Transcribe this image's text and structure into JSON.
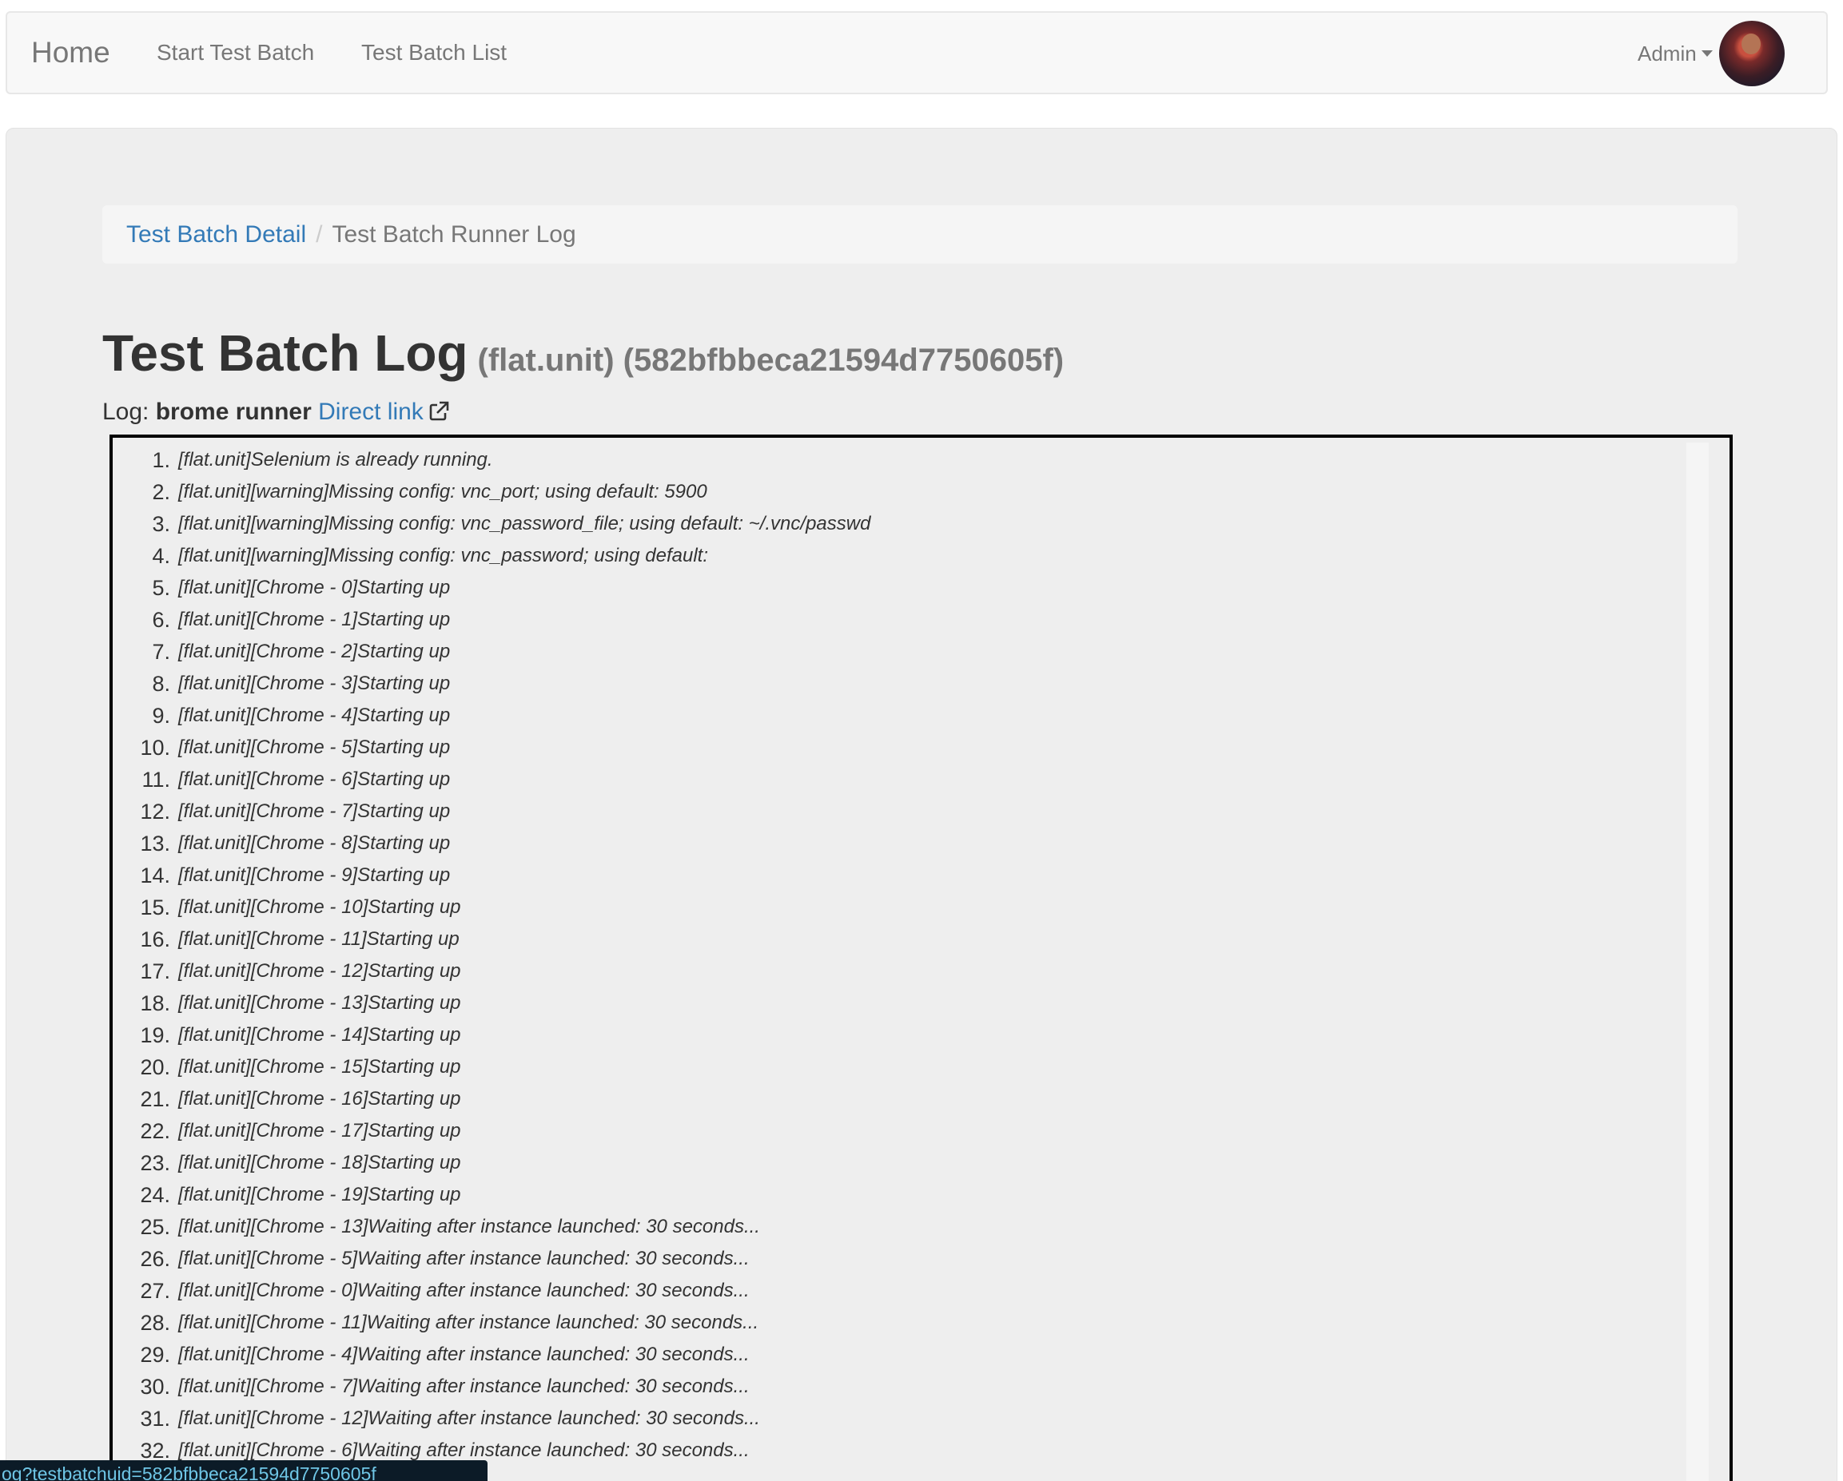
{
  "navbar": {
    "brand": "Home",
    "links": [
      "Start Test Batch",
      "Test Batch List"
    ],
    "user_label": "Admin"
  },
  "breadcrumb": {
    "link": "Test Batch Detail",
    "separator": "/",
    "active": "Test Batch Runner Log"
  },
  "header": {
    "title": "Test Batch Log",
    "subtitle": "(flat.unit) (582bfbbeca21594d7750605f)"
  },
  "log_info": {
    "prefix": "Log:",
    "name": "brome runner",
    "direct_link": "Direct link"
  },
  "log_lines": [
    {
      "num": "1.",
      "text": "[flat.unit]Selenium is already running."
    },
    {
      "num": "2.",
      "text": "[flat.unit][warning]Missing config: vnc_port; using default: 5900"
    },
    {
      "num": "3.",
      "text": "[flat.unit][warning]Missing config: vnc_password_file; using default: ~/.vnc/passwd"
    },
    {
      "num": "4.",
      "text": "[flat.unit][warning]Missing config: vnc_password; using default:"
    },
    {
      "num": "5.",
      "text": "[flat.unit][Chrome - 0]Starting up"
    },
    {
      "num": "6.",
      "text": "[flat.unit][Chrome - 1]Starting up"
    },
    {
      "num": "7.",
      "text": "[flat.unit][Chrome - 2]Starting up"
    },
    {
      "num": "8.",
      "text": "[flat.unit][Chrome - 3]Starting up"
    },
    {
      "num": "9.",
      "text": "[flat.unit][Chrome - 4]Starting up"
    },
    {
      "num": "10.",
      "text": "[flat.unit][Chrome - 5]Starting up"
    },
    {
      "num": "11.",
      "text": "[flat.unit][Chrome - 6]Starting up"
    },
    {
      "num": "12.",
      "text": "[flat.unit][Chrome - 7]Starting up"
    },
    {
      "num": "13.",
      "text": "[flat.unit][Chrome - 8]Starting up"
    },
    {
      "num": "14.",
      "text": "[flat.unit][Chrome - 9]Starting up"
    },
    {
      "num": "15.",
      "text": "[flat.unit][Chrome - 10]Starting up"
    },
    {
      "num": "16.",
      "text": "[flat.unit][Chrome - 11]Starting up"
    },
    {
      "num": "17.",
      "text": "[flat.unit][Chrome - 12]Starting up"
    },
    {
      "num": "18.",
      "text": "[flat.unit][Chrome - 13]Starting up"
    },
    {
      "num": "19.",
      "text": "[flat.unit][Chrome - 14]Starting up"
    },
    {
      "num": "20.",
      "text": "[flat.unit][Chrome - 15]Starting up"
    },
    {
      "num": "21.",
      "text": "[flat.unit][Chrome - 16]Starting up"
    },
    {
      "num": "22.",
      "text": "[flat.unit][Chrome - 17]Starting up"
    },
    {
      "num": "23.",
      "text": "[flat.unit][Chrome - 18]Starting up"
    },
    {
      "num": "24.",
      "text": "[flat.unit][Chrome - 19]Starting up"
    },
    {
      "num": "25.",
      "text": "[flat.unit][Chrome - 13]Waiting after instance launched: 30 seconds..."
    },
    {
      "num": "26.",
      "text": "[flat.unit][Chrome - 5]Waiting after instance launched: 30 seconds..."
    },
    {
      "num": "27.",
      "text": "[flat.unit][Chrome - 0]Waiting after instance launched: 30 seconds..."
    },
    {
      "num": "28.",
      "text": "[flat.unit][Chrome - 11]Waiting after instance launched: 30 seconds..."
    },
    {
      "num": "29.",
      "text": "[flat.unit][Chrome - 4]Waiting after instance launched: 30 seconds..."
    },
    {
      "num": "30.",
      "text": "[flat.unit][Chrome - 7]Waiting after instance launched: 30 seconds..."
    },
    {
      "num": "31.",
      "text": "[flat.unit][Chrome - 12]Waiting after instance launched: 30 seconds..."
    },
    {
      "num": "32.",
      "text": "[flat.unit][Chrome - 6]Waiting after instance launched: 30 seconds..."
    }
  ],
  "status_bar": {
    "url": "og?testbatchuid=582bfbbeca21594d7750605f"
  }
}
